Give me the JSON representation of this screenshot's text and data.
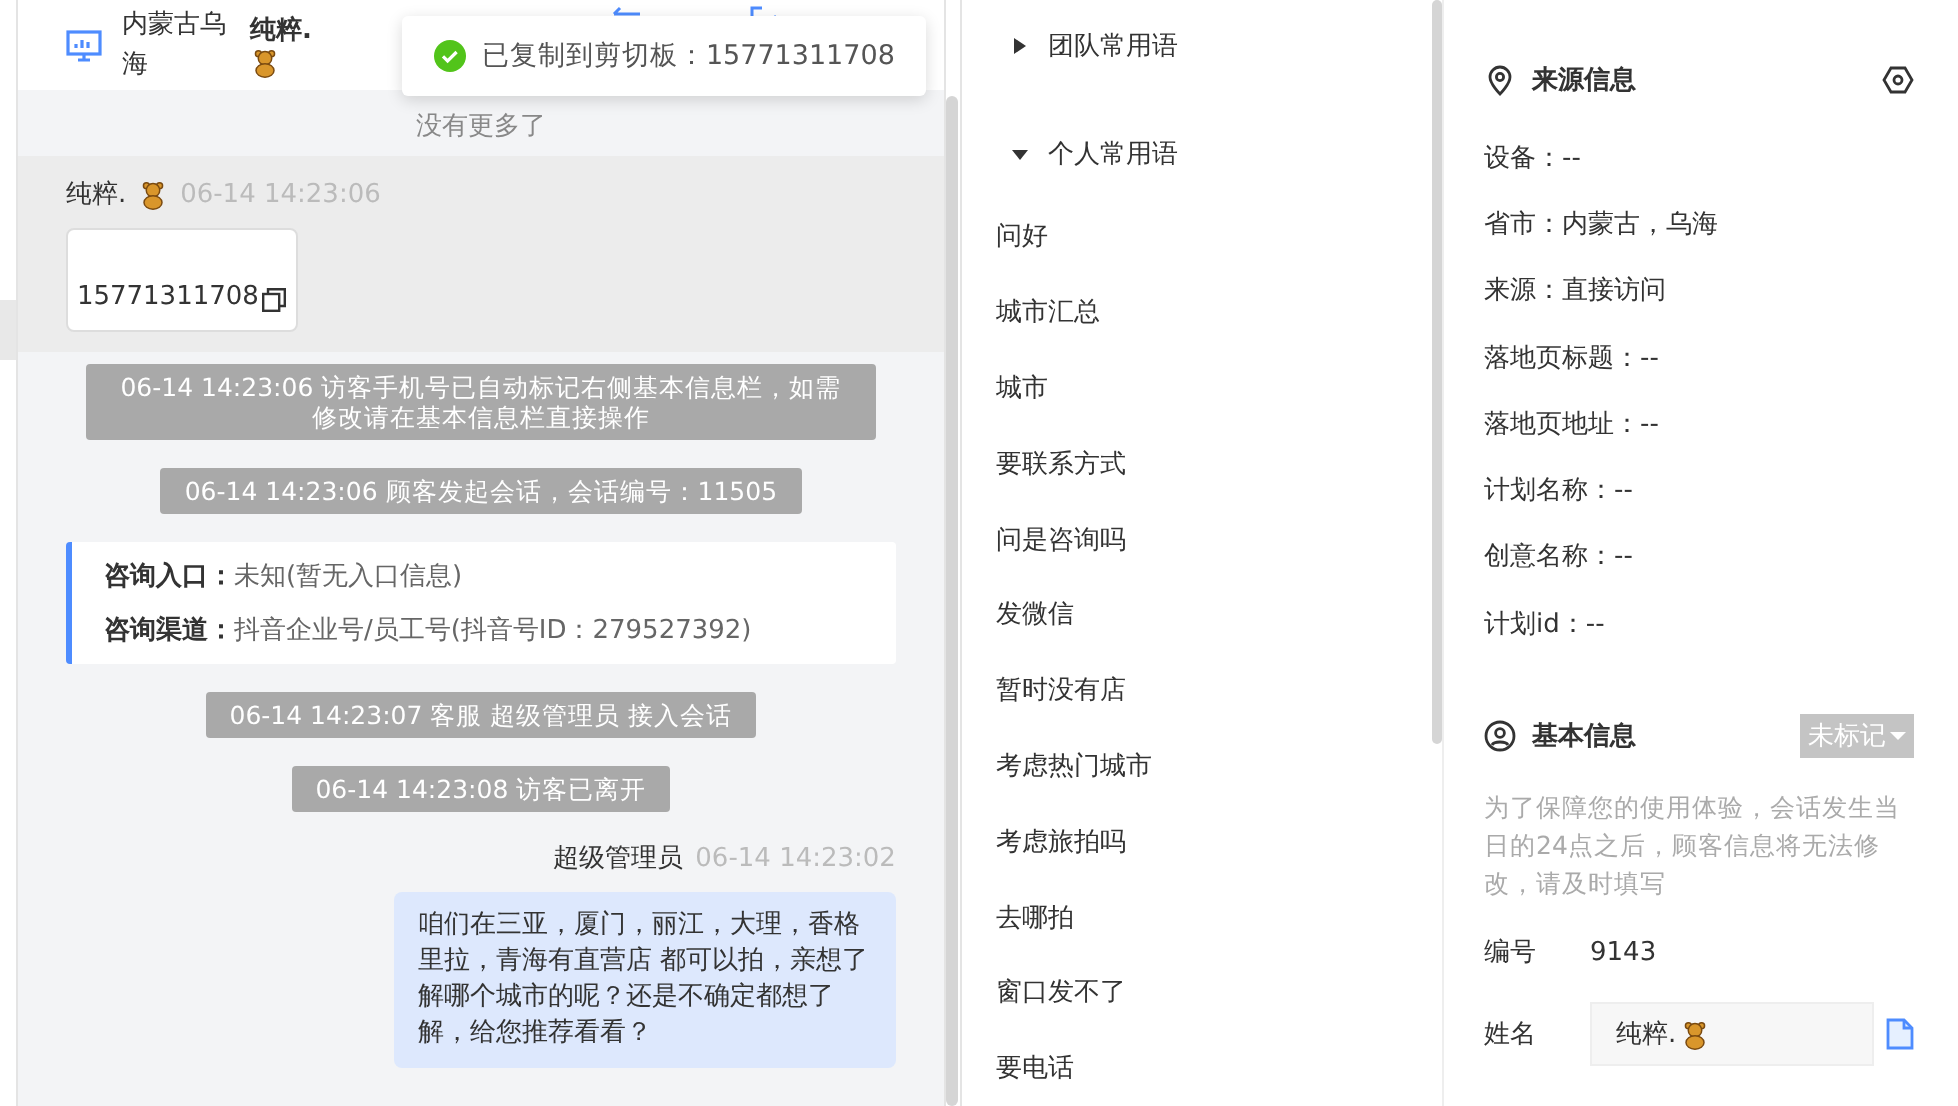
{
  "header": {
    "location": "内蒙古乌海",
    "visitor_name": "纯粹."
  },
  "toast": {
    "text": "已复制到剪切板：15771311708"
  },
  "chat": {
    "no_more": "没有更多了",
    "messages": [
      {
        "kind": "visitor",
        "sender": "纯粹.",
        "time": "06-14 14:23:06",
        "text": "15771311708"
      },
      {
        "kind": "system",
        "text": "06-14 14:23:06 访客手机号已自动标记右侧基本信息栏，如需修改请在基本信息栏直接操作"
      },
      {
        "kind": "system",
        "text": "06-14 14:23:06 顾客发起会话，会话编号：11505"
      },
      {
        "kind": "info",
        "rows": [
          {
            "label": "咨询入口：",
            "value": "未知(暂无入口信息)"
          },
          {
            "label": "咨询渠道：",
            "value": "抖音企业号/员工号(抖音号ID：279527392)"
          }
        ]
      },
      {
        "kind": "system",
        "text": "06-14 14:23:07 客服 超级管理员 接入会话"
      },
      {
        "kind": "system",
        "text": "06-14 14:23:08 访客已离开"
      },
      {
        "kind": "agent",
        "sender": "超级管理员",
        "time": "06-14 14:23:02",
        "text": "咱们在三亚，厦门，丽江，大理，香格里拉，青海有直营店 都可以拍，亲想了解哪个城市的呢？还是不确定都想了解，给您推荐看看？"
      }
    ]
  },
  "phrases": [
    {
      "label": "团队常用语",
      "expanded": false
    },
    {
      "label": "个人常用语",
      "expanded": true,
      "children": [
        "问好",
        "城市汇总",
        "城市",
        "要联系方式",
        "问是咨询吗",
        "发微信",
        "暂时没有店",
        "考虑热门城市",
        "考虑旅拍吗",
        "去哪拍",
        "窗口发不了",
        "要电话"
      ]
    }
  ],
  "source": {
    "title": "来源信息",
    "lines": [
      "设备：--",
      "省市：内蒙古，乌海",
      "来源：直接访问",
      "落地页标题：--",
      "落地页地址：--",
      "计划名称：--",
      "创意名称：--",
      "计划id：--"
    ]
  },
  "basic": {
    "title": "基本信息",
    "tag": "未标记",
    "note": "为了保障您的使用体验，会话发生当日的24点之后，顾客信息将无法修改，请及时填写",
    "number_label": "编号",
    "number": "9143",
    "name_label": "姓名",
    "name_value": "纯粹."
  }
}
